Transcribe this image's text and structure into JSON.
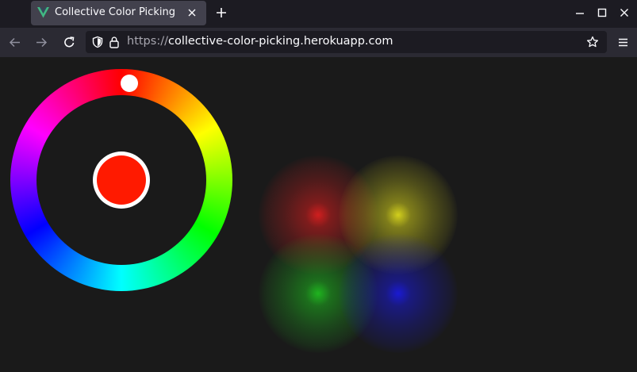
{
  "browser": {
    "tab_title": "Collective Color Picking",
    "url_scheme": "https://",
    "url_host": "collective-color-picking.herokuapp.com"
  },
  "colors": {
    "favicon_green": "#41b883",
    "favicon_dark": "#35495e",
    "selected_color": "#ff1a00",
    "user_colors": [
      "#d01e1e",
      "#d2cf1c",
      "#1fb41f",
      "#1a1ad2"
    ]
  },
  "icons": {
    "back": "arrow-left-icon",
    "forward": "arrow-right-icon",
    "reload": "reload-icon",
    "shield": "tracking-protection-shield-icon",
    "lock": "lock-icon",
    "bookmark": "star-icon",
    "menu": "hamburger-menu-icon"
  }
}
